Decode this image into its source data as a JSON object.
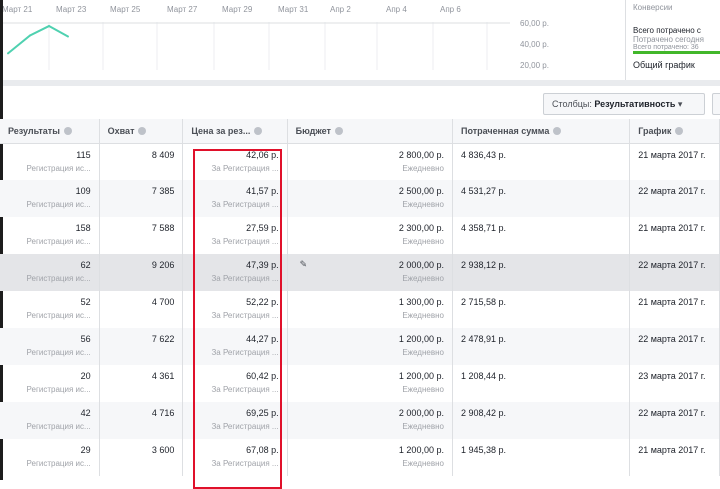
{
  "chart": {
    "x_labels": [
      "Март 21",
      "Март 23",
      "Март 25",
      "Март 27",
      "Март 29",
      "Март 31",
      "Апр 2",
      "Апр 4",
      "Апр 6"
    ],
    "y_labels": [
      "60,00 р.",
      "40,00 р.",
      "20,00 р."
    ],
    "chart_data": {
      "type": "line",
      "series": [
        {
          "name": "Цена за результат",
          "values": [
            33,
            50,
            59,
            49
          ]
        }
      ],
      "ylim": [
        20,
        60
      ],
      "color": "#4fd1b0"
    }
  },
  "side": {
    "conversions": "Конверсии",
    "total_spent": "Всего потрачено с",
    "today": "Потрачено сегодня",
    "total_line": "Всего потрачено: 36",
    "overall": "Общий график"
  },
  "toolbar": {
    "columns_label": "Столбцы:",
    "columns_value": "Результативность"
  },
  "headers": [
    "Результаты",
    "Охват",
    "Цена за рез...",
    "Бюджет",
    "Потраченная сумма",
    "График"
  ],
  "rows": [
    {
      "results": "115",
      "results_sub": "Регистрация ис...",
      "reach": "8 409",
      "cost": "42,06 р.",
      "cost_sub": "За Регистрация ...",
      "budget": "2 800,00 р.",
      "budget_sub": "Ежедневно",
      "spent": "4 836,43 р.",
      "schedule": "21 марта 2017 г."
    },
    {
      "results": "109",
      "results_sub": "Регистрация ис...",
      "reach": "7 385",
      "cost": "41,57 р.",
      "cost_sub": "За Регистрация ...",
      "budget": "2 500,00 р.",
      "budget_sub": "Ежедневно",
      "spent": "4 531,27 р.",
      "schedule": "22 марта 2017 г."
    },
    {
      "results": "158",
      "results_sub": "Регистрация ис...",
      "reach": "7 588",
      "cost": "27,59 р.",
      "cost_sub": "За Регистрация ...",
      "budget": "2 300,00 р.",
      "budget_sub": "Ежедневно",
      "spent": "4 358,71 р.",
      "schedule": "21 марта 2017 г."
    },
    {
      "results": "62",
      "results_sub": "Регистрация ис...",
      "reach": "9 206",
      "cost": "47,39 р.",
      "cost_sub": "За Регистрация ...",
      "budget": "2 000,00 р.",
      "budget_sub": "Ежедневно",
      "spent": "2 938,12 р.",
      "schedule": "22 марта 2017 г."
    },
    {
      "results": "52",
      "results_sub": "Регистрация ис...",
      "reach": "4 700",
      "cost": "52,22 р.",
      "cost_sub": "За Регистрация ...",
      "budget": "1 300,00 р.",
      "budget_sub": "Ежедневно",
      "spent": "2 715,58 р.",
      "schedule": "21 марта 2017 г."
    },
    {
      "results": "56",
      "results_sub": "Регистрация ис...",
      "reach": "7 622",
      "cost": "44,27 р.",
      "cost_sub": "За Регистрация ...",
      "budget": "1 200,00 р.",
      "budget_sub": "Ежедневно",
      "spent": "2 478,91 р.",
      "schedule": "22 марта 2017 г."
    },
    {
      "results": "20",
      "results_sub": "Регистрация ис...",
      "reach": "4 361",
      "cost": "60,42 р.",
      "cost_sub": "За Регистрация ...",
      "budget": "1 200,00 р.",
      "budget_sub": "Ежедневно",
      "spent": "1 208,44 р.",
      "schedule": "23 марта 2017 г."
    },
    {
      "results": "42",
      "results_sub": "Регистрация ис...",
      "reach": "4 716",
      "cost": "69,25 р.",
      "cost_sub": "За Регистрация ...",
      "budget": "2 000,00 р.",
      "budget_sub": "Ежедневно",
      "spent": "2 908,42 р.",
      "schedule": "22 марта 2017 г."
    },
    {
      "results": "29",
      "results_sub": "Регистрация ис...",
      "reach": "3 600",
      "cost": "67,08 р.",
      "cost_sub": "За Регистрация ...",
      "budget": "1 200,00 р.",
      "budget_sub": "Ежедневно",
      "spent": "1 945,38 р.",
      "schedule": "21 марта 2017 г."
    }
  ]
}
